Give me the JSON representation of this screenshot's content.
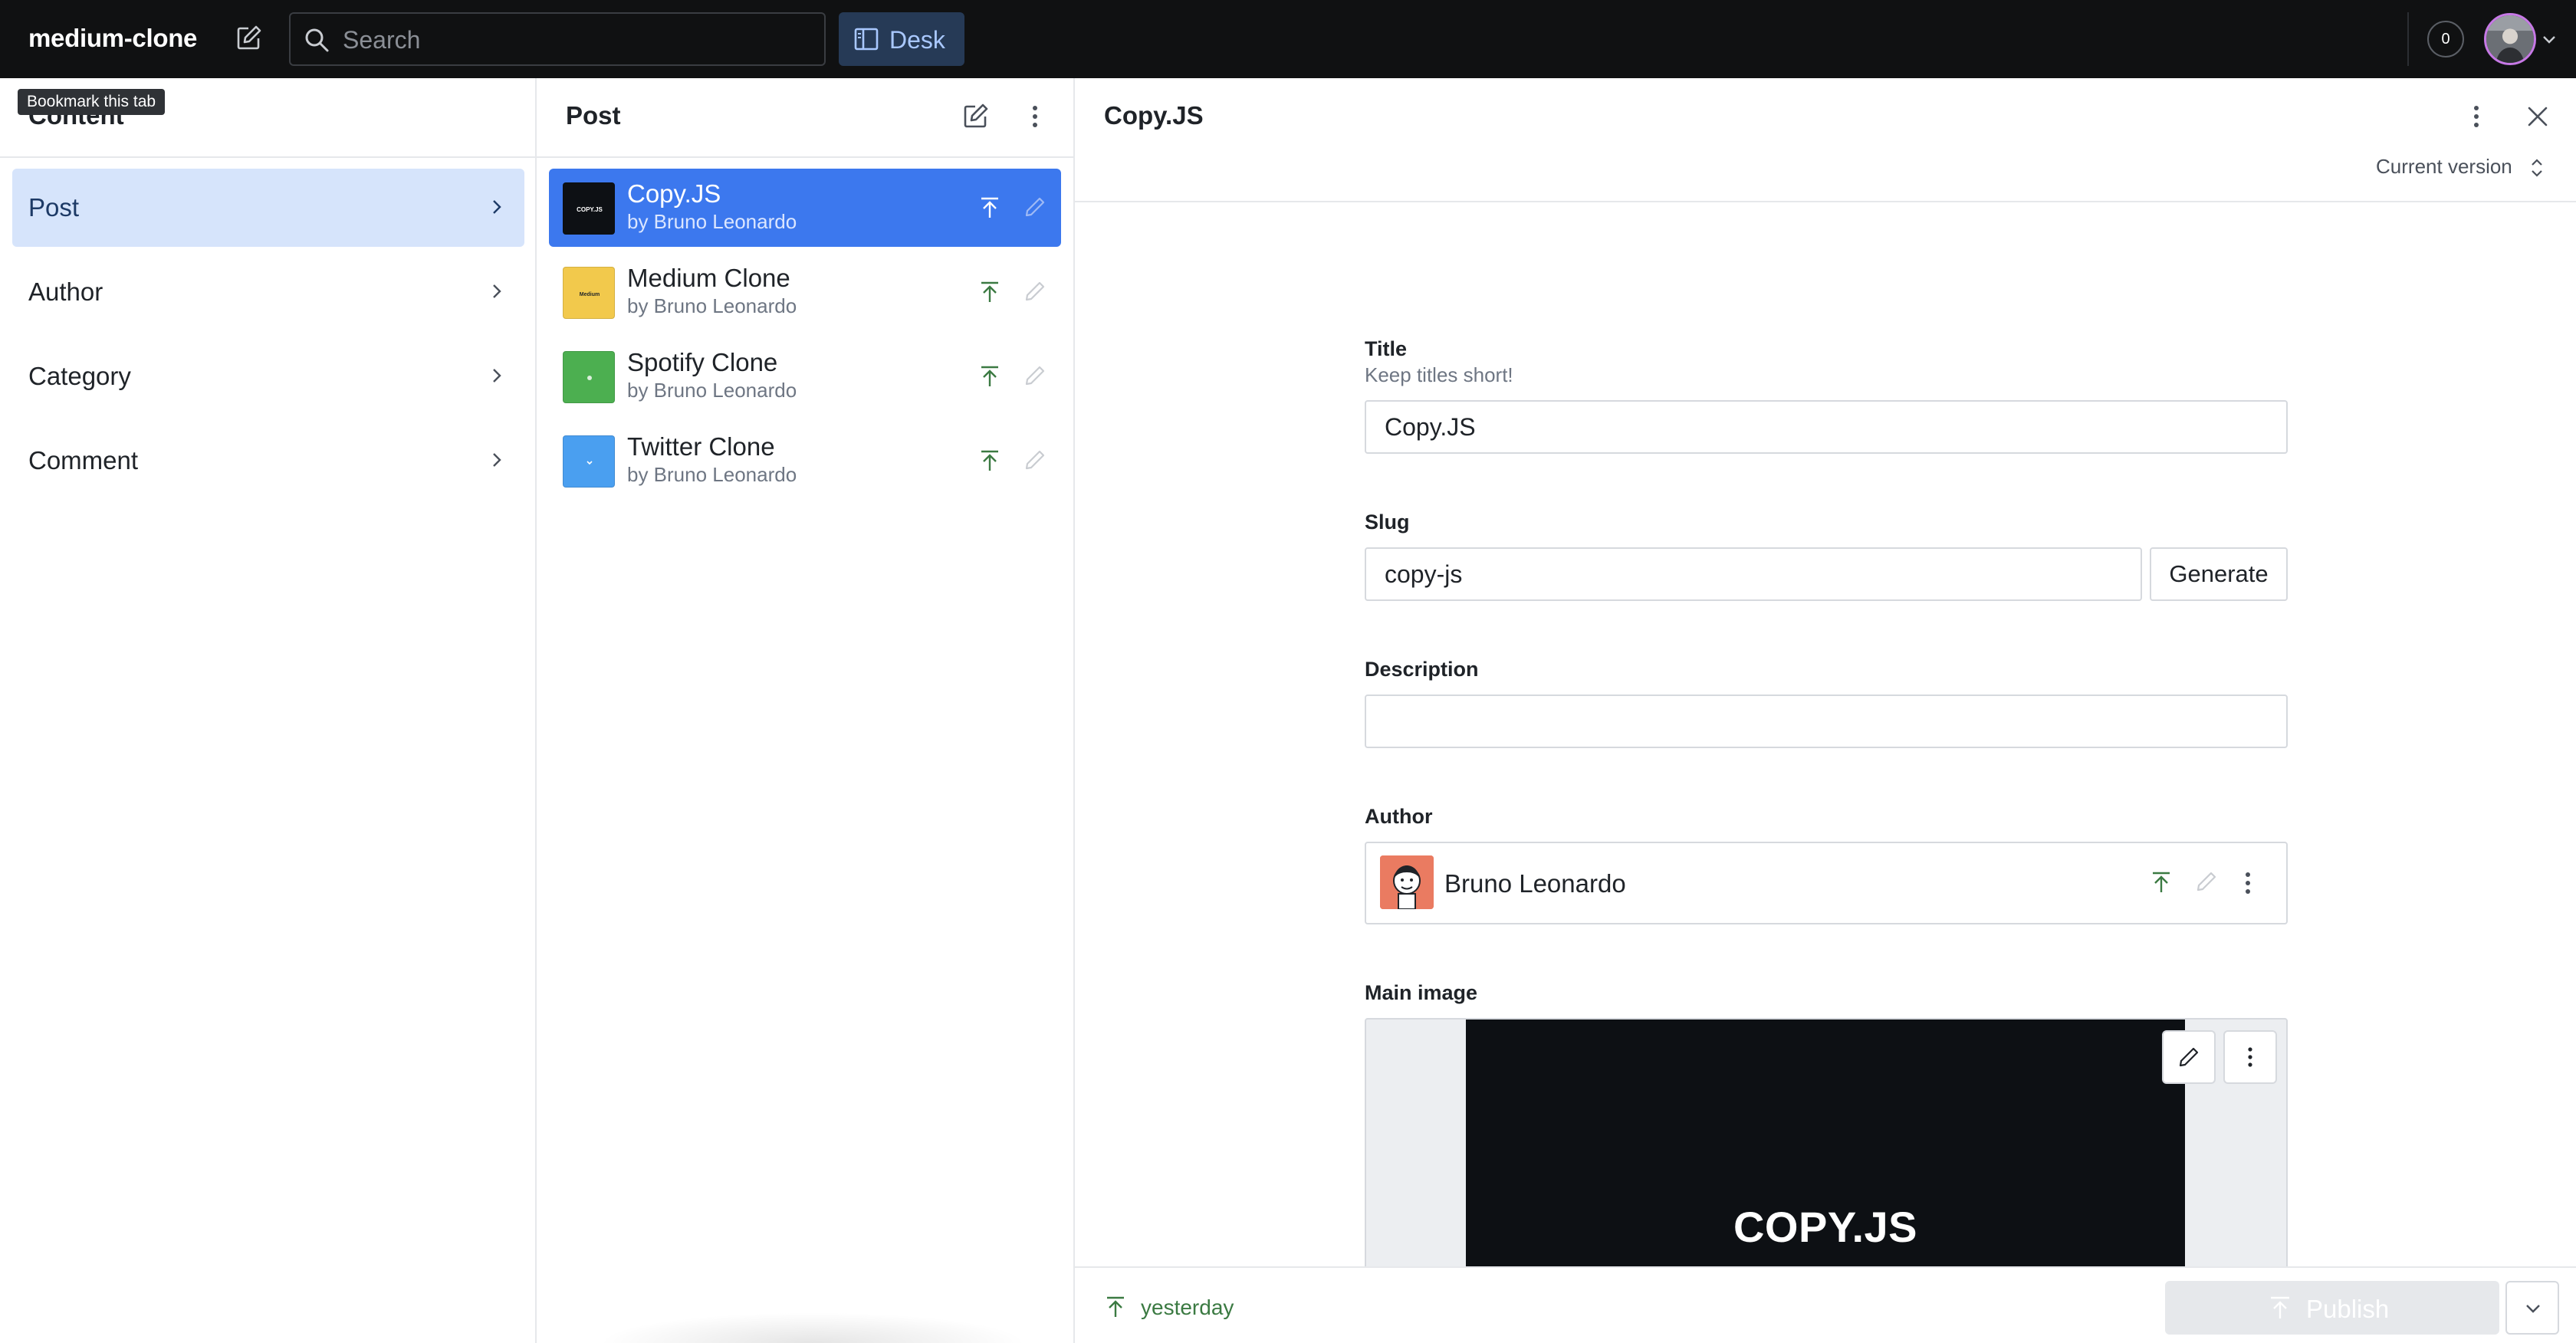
{
  "topbar": {
    "brand": "medium-clone",
    "search_placeholder": "Search",
    "desk_label": "Desk",
    "notification_count": "0"
  },
  "tooltip": "Bookmark this tab",
  "content_pane": {
    "title": "Content",
    "items": [
      {
        "label": "Post",
        "active": true
      },
      {
        "label": "Author",
        "active": false
      },
      {
        "label": "Category",
        "active": false
      },
      {
        "label": "Comment",
        "active": false
      }
    ]
  },
  "list_pane": {
    "title": "Post",
    "documents": [
      {
        "title": "Copy.JS",
        "subtitle": "by Bruno Leonardo",
        "thumb_color": "#0d1014",
        "thumb_text": "COPY.JS",
        "active": true
      },
      {
        "title": "Medium Clone",
        "subtitle": "by Bruno Leonardo",
        "thumb_color": "#f2c94c",
        "thumb_text": "Medium",
        "active": false
      },
      {
        "title": "Spotify Clone",
        "subtitle": "by Bruno Leonardo",
        "thumb_color": "#4caf50",
        "thumb_text": "",
        "active": false
      },
      {
        "title": "Twitter Clone",
        "subtitle": "by Bruno Leonardo",
        "thumb_color": "#4a9ff0",
        "thumb_text": "",
        "active": false
      }
    ]
  },
  "document": {
    "title": "Copy.JS",
    "version_label": "Current version",
    "fields": {
      "title": {
        "label": "Title",
        "description": "Keep titles short!",
        "value": "Copy.JS"
      },
      "slug": {
        "label": "Slug",
        "value": "copy-js",
        "button": "Generate"
      },
      "description": {
        "label": "Description",
        "value": ""
      },
      "author": {
        "label": "Author",
        "name": "Bruno Leonardo"
      },
      "main_image": {
        "label": "Main image",
        "image_text": "COPY.JS"
      }
    },
    "footer": {
      "status": "yesterday",
      "publish_label": "Publish"
    }
  },
  "colors": {
    "topbar_bg": "#101112",
    "active_nav_bg": "#d6e4fb",
    "active_doc_bg": "#3c78ee",
    "published_green": "#3b7a42"
  },
  "icons": [
    "compose-icon",
    "search-icon",
    "desk-icon",
    "chevron-right-icon",
    "kebab-menu-icon",
    "close-icon",
    "publish-icon",
    "pencil-icon",
    "chevron-down-icon",
    "up-down-icon"
  ]
}
